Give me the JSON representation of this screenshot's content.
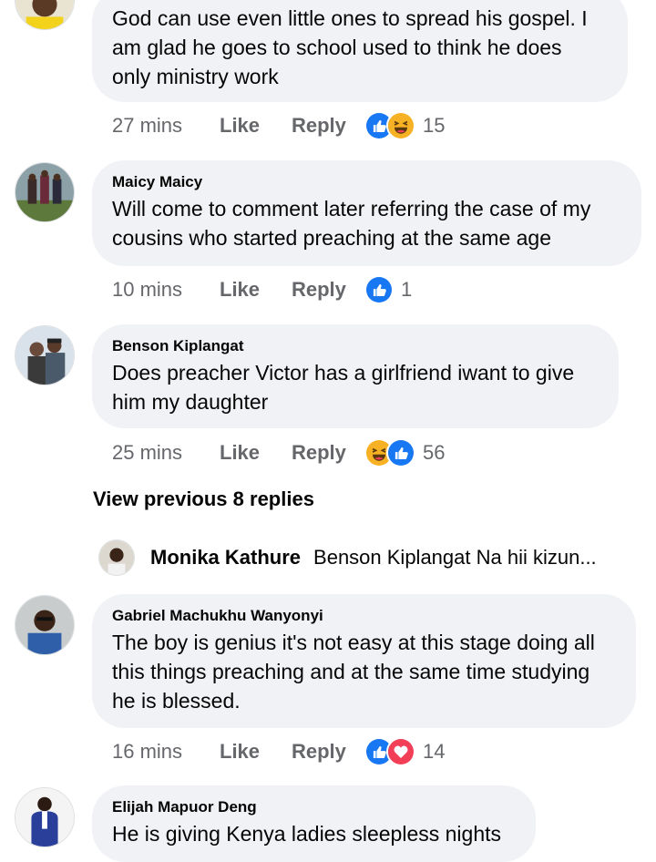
{
  "comments": [
    {
      "author": "",
      "lines": [
        "God can use even little ones to spread his gospel. I",
        "am glad he goes to school used to think he does",
        "only ministry work"
      ],
      "time": "27 mins",
      "like_label": "Like",
      "reply_label": "Reply",
      "reactions": [
        "like-icon",
        "haha-icon"
      ],
      "reaction_count": "15"
    },
    {
      "author": "Maicy Maicy",
      "lines": [
        "Will come to comment later referring the case of my",
        "cousins who started preaching at the same age"
      ],
      "time": "10 mins",
      "like_label": "Like",
      "reply_label": "Reply",
      "reactions": [
        "like-icon"
      ],
      "reaction_count": "1"
    },
    {
      "author": "Benson Kiplangat",
      "lines": [
        "Does preacher Victor has a girlfriend iwant to give",
        "him my daughter"
      ],
      "time": "25 mins",
      "like_label": "Like",
      "reply_label": "Reply",
      "reactions": [
        "haha-icon",
        "like-icon"
      ],
      "reaction_count": "56"
    },
    {
      "author": "Gabriel Machukhu Wanyonyi",
      "lines": [
        "The boy is genius it's not easy at this stage doing all",
        "this things preaching and at the same time studying",
        "he is blessed."
      ],
      "time": "16 mins",
      "like_label": "Like",
      "reply_label": "Reply",
      "reactions": [
        "like-icon",
        "love-icon"
      ],
      "reaction_count": "14"
    },
    {
      "author": "Elijah Mapuor Deng",
      "lines": [
        "He is giving Kenya ladies sleepless nights"
      ]
    }
  ],
  "view_previous": "View previous 8 replies",
  "latest_reply": {
    "author": "Monika Kathure",
    "snippet": "Benson Kiplangat Na hii kizun..."
  },
  "colors": {
    "bubble": "#f0f2f5",
    "meta_text": "#65676b",
    "like_blue": "#1877f2",
    "haha_yellow": "#f7b125",
    "love_red": "#f33e58"
  }
}
